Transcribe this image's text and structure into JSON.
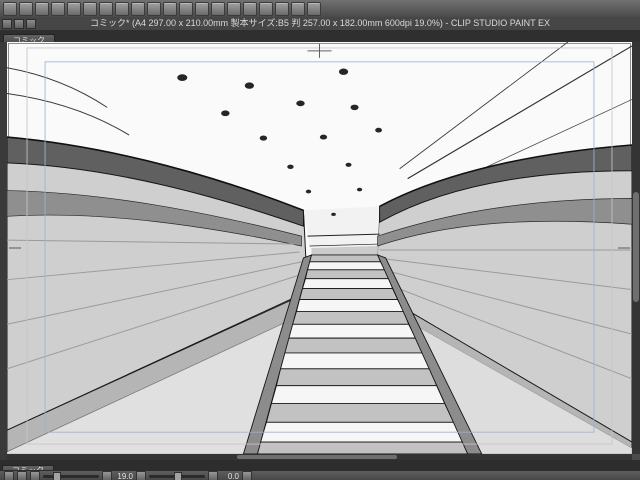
{
  "window": {
    "title": "コミック* (A4 297.00 x 210.00mm 製本サイズ:B5 判 257.00 x 182.00mm 600dpi 19.0%) - CLIP STUDIO PAINT EX"
  },
  "toolbar": {
    "icons": [
      "app-menu-icon",
      "new-document-icon",
      "open-file-icon",
      "save-icon",
      "export-icon",
      "undo-icon",
      "redo-icon",
      "cut-icon",
      "copy-icon",
      "paste-icon",
      "delete-icon",
      "fill-icon",
      "select-icon",
      "deselect-icon",
      "zoom-in-icon",
      "zoom-out-icon",
      "hand-tool-icon",
      "rotate-canvas-icon",
      "grid-icon",
      "snap-icon"
    ]
  },
  "doc_controls": {
    "icons": [
      "doc-minimize-icon",
      "doc-restore-icon",
      "doc-close-icon"
    ]
  },
  "canvas_tab": {
    "label": "コミック"
  },
  "bottom_tab": {
    "label": "コミック"
  },
  "statusbar": {
    "left_icons": [
      "navigator-icon",
      "subview-icon"
    ],
    "zoom_value": "19.0",
    "rotation_value": "0.0"
  },
  "colors": {
    "paper": "#fafafa",
    "ink": "#1b1b1b",
    "guide_blue": "#9fb0d6",
    "guide_gray": "#c6c6c6",
    "chrome_dark": "#4b4b4b"
  }
}
